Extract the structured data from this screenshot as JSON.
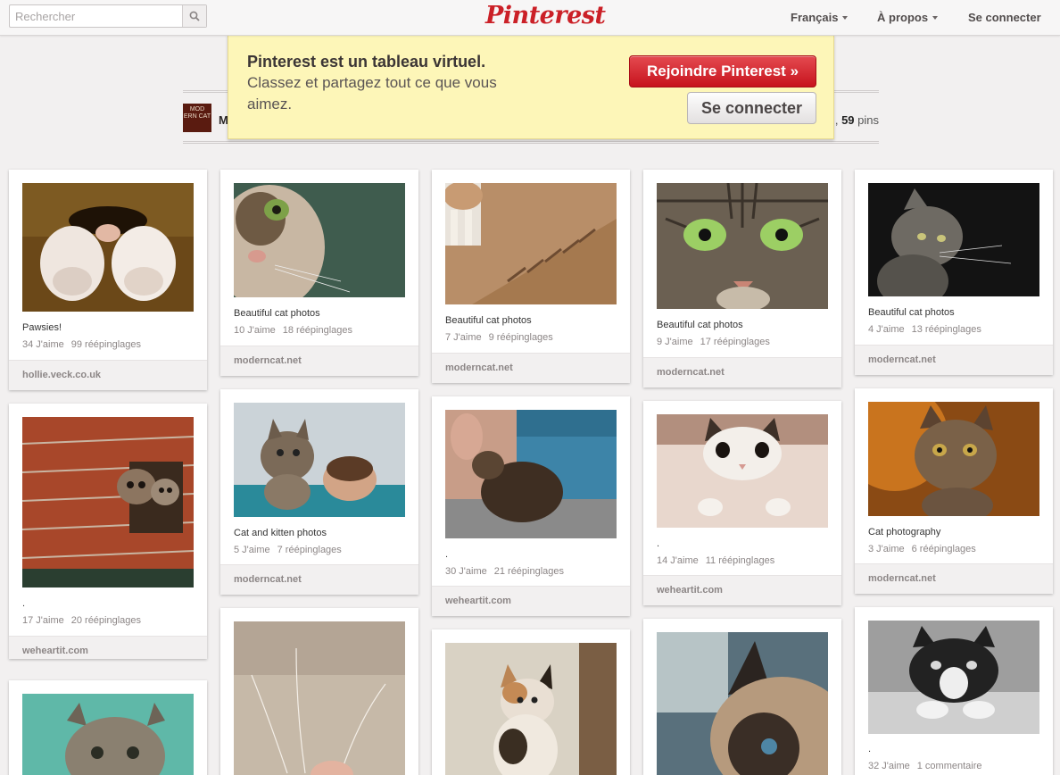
{
  "header": {
    "search_placeholder": "Rechercher",
    "logo": "Pinterest",
    "nav": {
      "language": "Français",
      "about": "À propos",
      "login": "Se connecter"
    }
  },
  "banner": {
    "title": "Pinterest est un tableau virtuel.",
    "text": "Classez et partagez tout ce que vous aimez.",
    "join_button": "Rejoindre Pinterest »",
    "login_button": "Se connecter"
  },
  "board": {
    "avatar_text": "MOD ERN CAT",
    "name": "M",
    "pins_prefix": ", ",
    "pin_count": "59",
    "pins_label": " pins"
  },
  "colors": {
    "brand_red": "#cb2027",
    "banner_yellow": "#fdf6b8",
    "background": "#f2f0f0"
  },
  "pins": [
    {
      "desc": "Pawsies!",
      "likes": "34 J'aime",
      "repins": "99 réépinglages",
      "source": "hollie.veck.co.uk"
    },
    {
      "desc": ".",
      "likes": "17 J'aime",
      "repins": "20 réépinglages",
      "source": "weheartit.com"
    },
    {
      "desc": "Beautiful cat photos",
      "likes": "10 J'aime",
      "repins": "18 réépinglages",
      "source": "moderncat.net"
    },
    {
      "desc": "Cat and kitten photos",
      "likes": "5 J'aime",
      "repins": "7 réépinglages",
      "source": "moderncat.net"
    },
    {
      "desc": "Beautiful cat photos",
      "likes": "7 J'aime",
      "repins": "9 réépinglages",
      "source": "moderncat.net"
    },
    {
      "desc": ".",
      "likes": "30 J'aime",
      "repins": "21 réépinglages",
      "source": "weheartit.com"
    },
    {
      "desc": "Beautiful cat photos",
      "likes": "9 J'aime",
      "repins": "17 réépinglages",
      "source": "moderncat.net"
    },
    {
      "desc": ".",
      "likes": "14 J'aime",
      "repins": "11 réépinglages",
      "source": "weheartit.com"
    },
    {
      "desc": "Beautiful cat photos",
      "likes": "4 J'aime",
      "repins": "13 réépinglages",
      "source": "moderncat.net"
    },
    {
      "desc": "Cat photography",
      "likes": "3 J'aime",
      "repins": "6 réépinglages",
      "source": "moderncat.net"
    },
    {
      "desc": ".",
      "likes": "32 J'aime",
      "repins": "1 commentaire"
    }
  ]
}
